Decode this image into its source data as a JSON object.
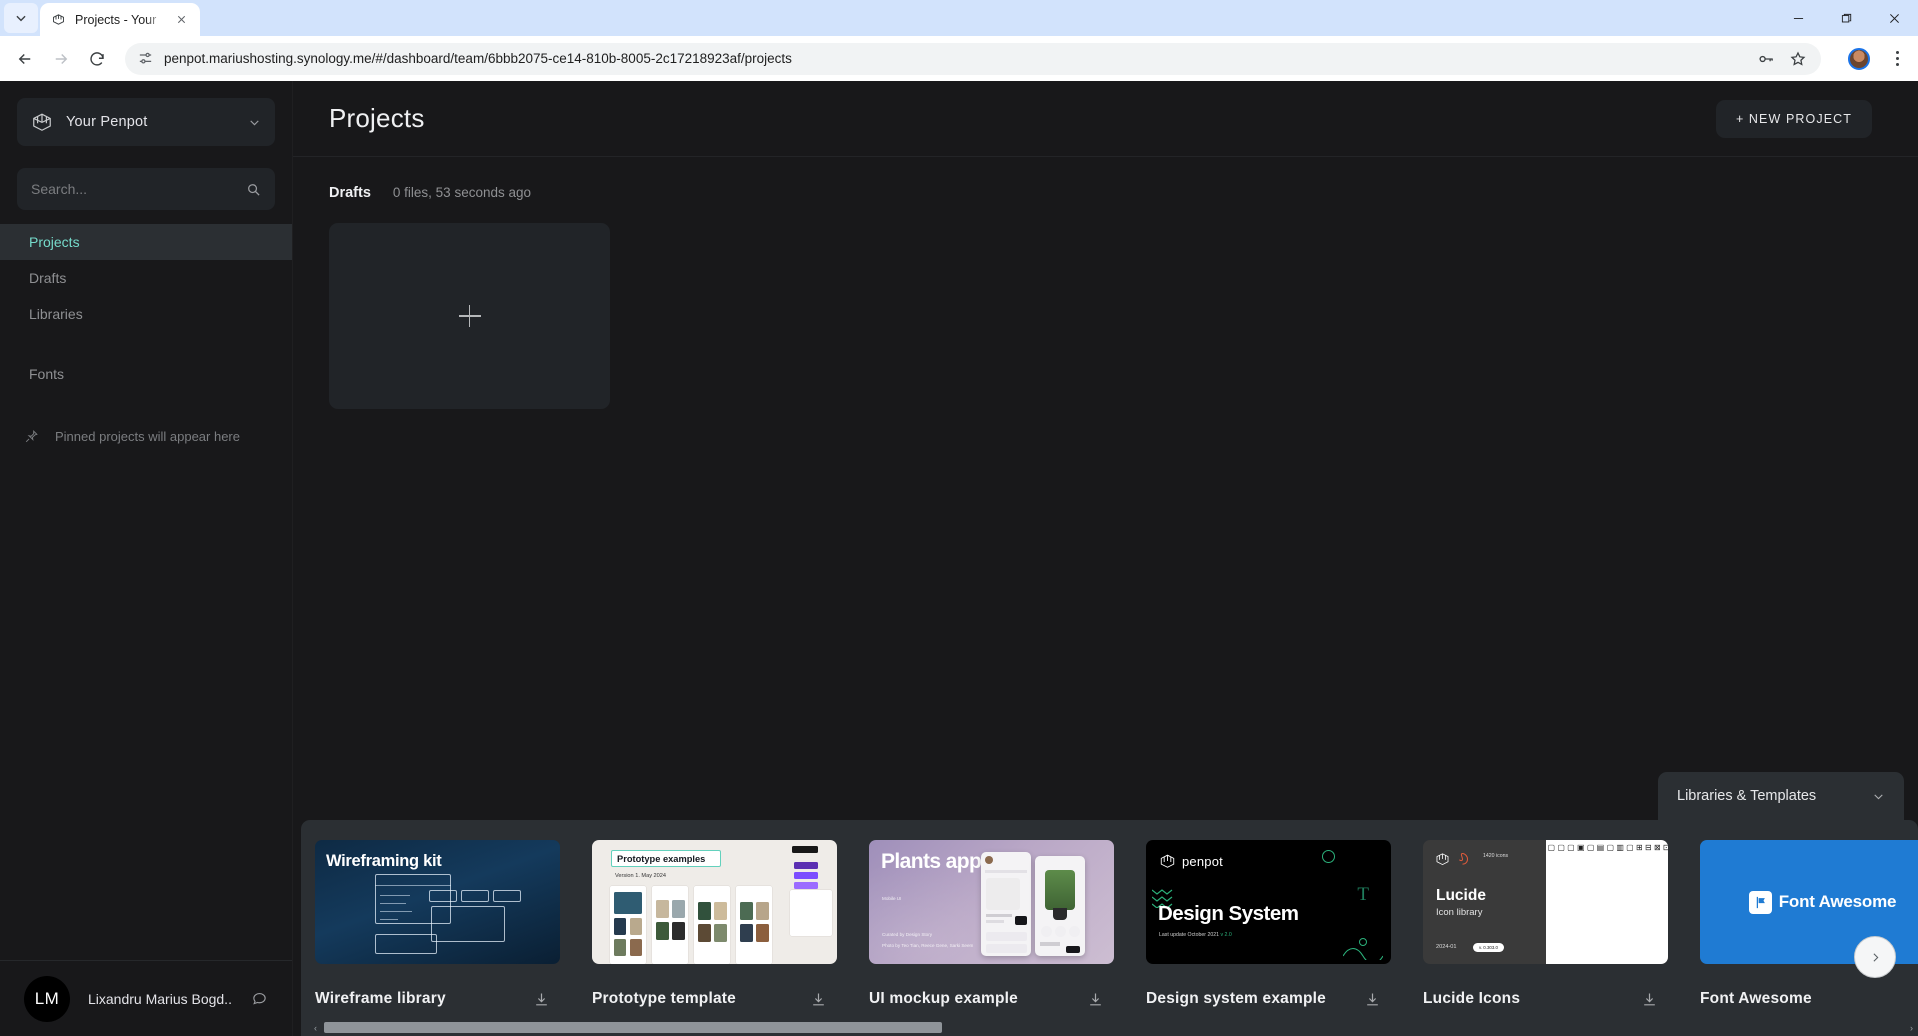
{
  "browser": {
    "tab": {
      "title": "Projects - Your",
      "favicon_icon": "penpot-favicon"
    },
    "tab_list_icon": "chevron-down-icon",
    "tab_close_icon": "close-icon",
    "window": {
      "minimize_icon": "minimize-icon",
      "maximize_icon": "maximize-icon",
      "close_icon": "window-close-icon"
    },
    "nav": {
      "back_icon": "arrow-left-icon",
      "forward_icon": "arrow-right-icon",
      "reload_icon": "reload-icon"
    },
    "omnibox": {
      "site_info_icon": "site-settings-icon",
      "url": "penpot.mariushosting.synology.me/#/dashboard/team/6bbb2075-ce14-810b-8005-2c17218923af/projects",
      "password_icon": "key-icon",
      "bookmark_icon": "star-icon"
    },
    "profile_icon": "account-avatar",
    "menu_icon": "kebab-menu-icon"
  },
  "sidebar": {
    "team": {
      "label": "Your Penpot",
      "logo_icon": "penpot-logo-icon",
      "chevron_icon": "chevron-down-icon"
    },
    "search": {
      "placeholder": "Search...",
      "value": "",
      "icon": "search-icon"
    },
    "items": [
      {
        "label": "Projects",
        "active": true
      },
      {
        "label": "Drafts",
        "active": false
      },
      {
        "label": "Libraries",
        "active": false
      },
      {
        "label": "Fonts",
        "active": false
      }
    ],
    "pinned": {
      "label": "Pinned projects will appear here",
      "icon": "pin-icon"
    },
    "profile": {
      "initials": "LM",
      "name": "Lixandru Marius Bogd...",
      "comment_icon": "comment-icon"
    }
  },
  "header": {
    "title": "Projects",
    "new_project_label": "+ NEW PROJECT"
  },
  "project": {
    "name": "Drafts",
    "meta": "0 files, 53 seconds ago",
    "new_file_icon": "plus-icon"
  },
  "libraries": {
    "panel_title": "Libraries & Templates",
    "collapse_icon": "chevron-down-icon",
    "next_icon": "chevron-right-icon",
    "download_icon": "download-icon",
    "templates": [
      {
        "name": "Wireframe library",
        "thumb": {
          "kind": "wireframing-kit",
          "headline": "Wireframing kit"
        }
      },
      {
        "name": "Prototype template",
        "thumb": {
          "kind": "prototype-examples",
          "headline": "Prototype examples",
          "subtitle": "Version 1. May 2024"
        }
      },
      {
        "name": "UI mockup example",
        "thumb": {
          "kind": "plants-app",
          "headline": "Plants app",
          "subtitle": "Mobile UI"
        }
      },
      {
        "name": "Design system example",
        "thumb": {
          "kind": "penpot-design-system",
          "brand": "penpot",
          "headline": "Design System",
          "subtitle": "Last update October 2021",
          "version": "v 2.0"
        }
      },
      {
        "name": "Lucide Icons",
        "thumb": {
          "kind": "lucide-icon-library",
          "headline": "Lucide",
          "subtitle": "Icon library",
          "date": "2024-01",
          "version_badge": "v. 0.303.0",
          "count": "1420 icons"
        }
      },
      {
        "name": "Font Awesome",
        "thumb": {
          "kind": "font-awesome",
          "headline": "Font Awesome"
        }
      }
    ]
  },
  "colors": {
    "accent": "#76dbcb",
    "app_bg": "#18181a",
    "panel_bg": "#212428",
    "lib_bg": "#2b2f33",
    "text": "#e3e3e8",
    "muted": "#8f9093"
  }
}
